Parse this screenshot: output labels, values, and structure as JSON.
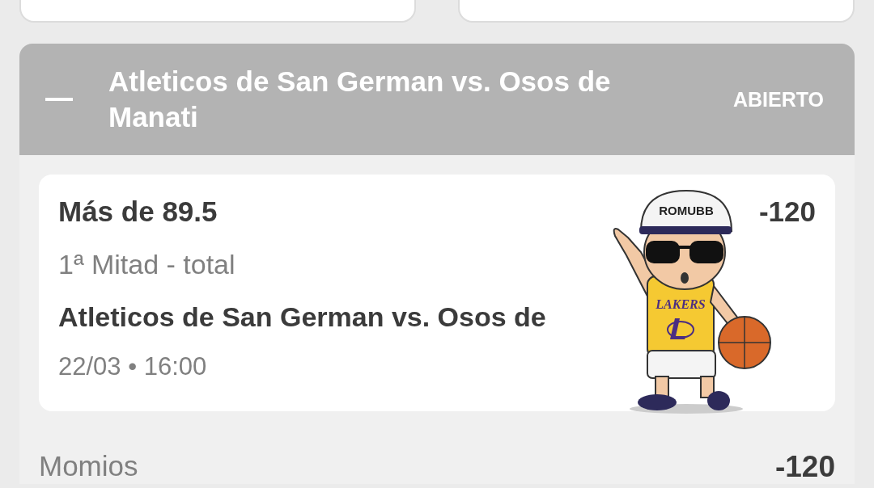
{
  "top_cards": [
    {
      "kind": "blank"
    },
    {
      "kind": "blank"
    }
  ],
  "event": {
    "title": "Atleticos de San German vs. Osos de Manati",
    "expanded": true,
    "status": "ABIERTO",
    "bet": {
      "selection": "Más de 89.5",
      "odds": "-120",
      "market": "1ª Mitad - total",
      "match": "Atleticos de San German vs. Osos de",
      "datetime": "22/03 • 16:00"
    },
    "sticker": {
      "cap_text": "ROMUBB",
      "jersey_text": "LAKERS"
    },
    "summary": {
      "label": "Momios",
      "value": "-120"
    }
  }
}
